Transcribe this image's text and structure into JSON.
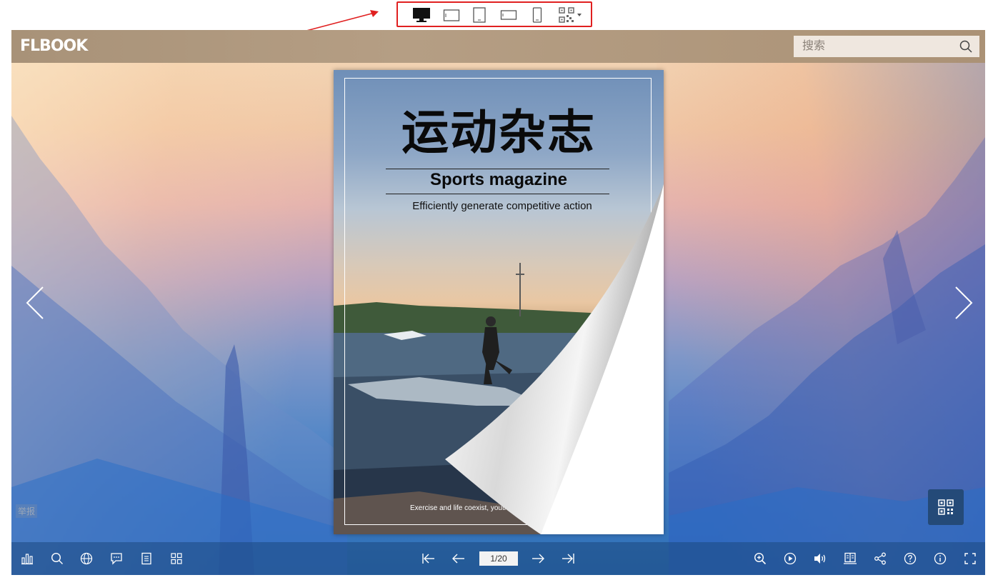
{
  "header": {
    "logo": "FLBOOK",
    "search_placeholder": "搜索"
  },
  "cover": {
    "title": "运动杂志",
    "subtitle": "Sports magazine",
    "tagline": "Efficiently generate competitive action",
    "footer": "Exercise and life coexist, youth"
  },
  "viewer": {
    "report_label": "举报"
  },
  "toolbar": {
    "page_indicator": "1/20"
  },
  "device_bar": {
    "devices": [
      "desktop-icon",
      "tablet-landscape-icon",
      "tablet-portrait-icon",
      "phone-landscape-icon",
      "phone-portrait-icon",
      "qr-code-icon"
    ]
  },
  "colors": {
    "header_bg": "#b59e84",
    "toolbar_bg": "#1c4880",
    "annotation": "#e02020",
    "qr_button_bg": "#244a78"
  }
}
